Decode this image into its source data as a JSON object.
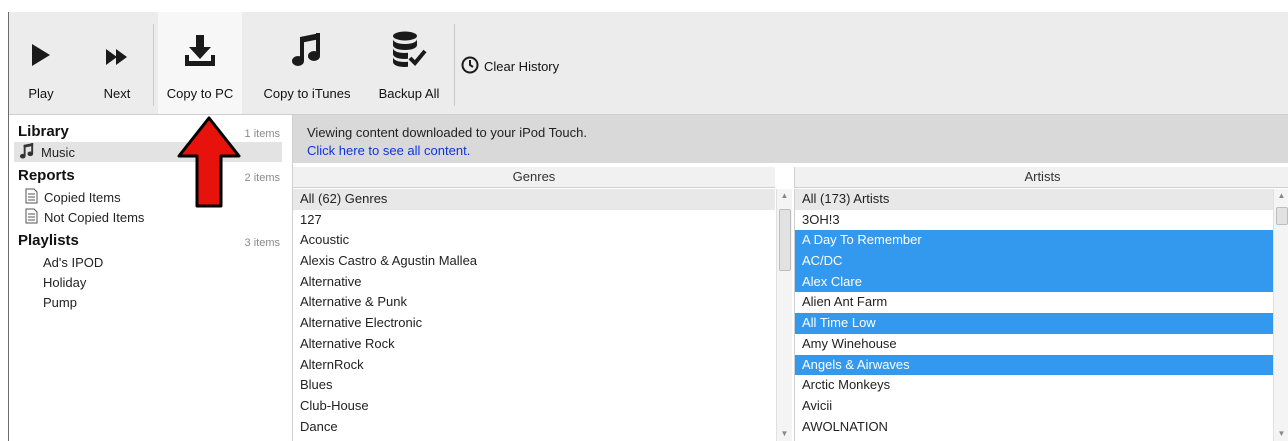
{
  "toolbar": {
    "buttons": [
      {
        "label": "Play",
        "icon": "play-icon"
      },
      {
        "label": "Next",
        "icon": "next-icon"
      },
      {
        "label": "Copy to PC",
        "icon": "download-icon"
      },
      {
        "label": "Copy to iTunes",
        "icon": "music-note-icon"
      },
      {
        "label": "Backup All",
        "icon": "database-check-icon"
      }
    ],
    "clear_history": "Clear History"
  },
  "sidebar": {
    "library": {
      "title": "Library",
      "count": "1 items",
      "items": [
        "Music"
      ]
    },
    "reports": {
      "title": "Reports",
      "count": "2 items",
      "items": [
        "Copied Items",
        "Not Copied Items"
      ]
    },
    "playlists": {
      "title": "Playlists",
      "count": "3 items",
      "items": [
        "Ad's IPOD",
        "Holiday",
        "Pump"
      ]
    }
  },
  "banner": {
    "message": "Viewing content downloaded to your iPod Touch.",
    "link": "Click here to see all content."
  },
  "genres": {
    "header": "Genres",
    "items": [
      "All (62) Genres",
      "127",
      "Acoustic",
      "Alexis Castro & Agustin Mallea",
      "Alternative",
      "Alternative & Punk",
      "Alternative Electronic",
      "Alternative Rock",
      "AlternRock",
      "Blues",
      "Club-House",
      "Dance"
    ]
  },
  "artists": {
    "header": "Artists",
    "items": [
      "All (173) Artists",
      "3OH!3",
      "A Day To Remember",
      "AC/DC",
      "Alex Clare",
      "Alien Ant Farm",
      "All Time Low",
      "Amy Winehouse",
      "Angels & Airwaves",
      "Arctic Monkeys",
      "Avicii",
      "AWOLNATION"
    ],
    "selected": [
      "A Day To Remember",
      "AC/DC",
      "Alex Clare",
      "All Time Low",
      "Angels & Airwaves"
    ]
  },
  "colors": {
    "selection": "#3399ee",
    "link": "#0a38d8",
    "arrow": "#e8120c"
  }
}
